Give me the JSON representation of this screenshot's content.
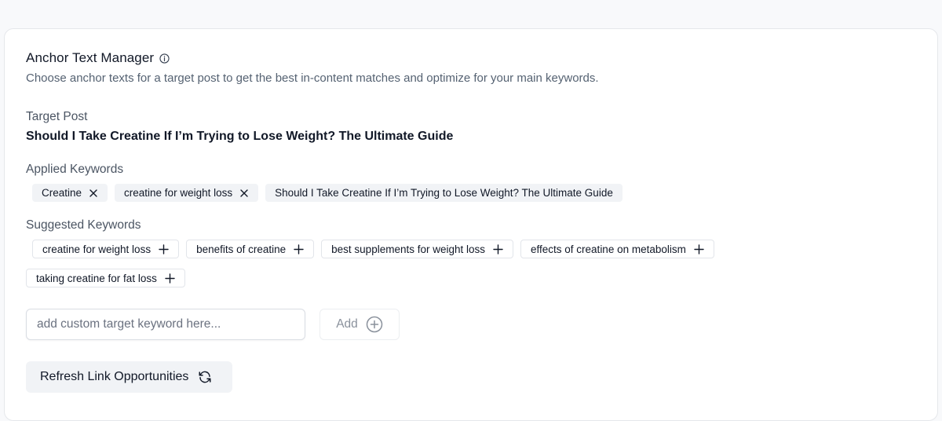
{
  "header": {
    "title": "Anchor Text Manager",
    "info_icon": "info-circle-icon",
    "subtitle": "Choose anchor texts for a target post to get the best in-content matches and optimize for your main keywords."
  },
  "target_post": {
    "label": "Target Post",
    "title": "Should I Take Creatine If I’m Trying to Lose Weight? The Ultimate Guide"
  },
  "applied_keywords": {
    "label": "Applied Keywords",
    "items": [
      {
        "text": "Creatine",
        "removable": true
      },
      {
        "text": "creatine for weight loss",
        "removable": true
      },
      {
        "text": "Should I Take Creatine If I’m Trying to Lose Weight? The Ultimate Guide",
        "removable": false
      }
    ]
  },
  "suggested_keywords": {
    "label": "Suggested Keywords",
    "items": [
      "creatine for weight loss",
      "benefits of creatine",
      "best supplements for weight loss",
      "effects of creatine on metabolism",
      "taking creatine for fat loss"
    ]
  },
  "custom_keyword": {
    "placeholder": "add custom target keyword here...",
    "value": "",
    "add_label": "Add"
  },
  "refresh": {
    "label": "Refresh Link Opportunities"
  }
}
